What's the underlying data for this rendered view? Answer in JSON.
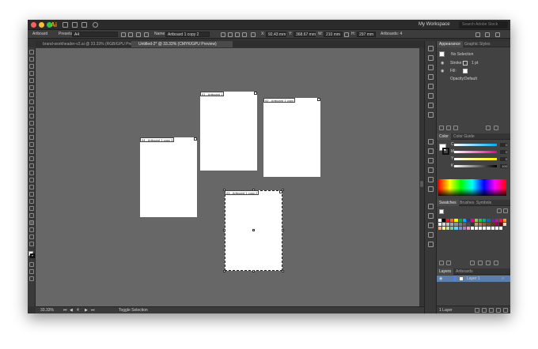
{
  "menubar": {
    "app_logo": "Ai",
    "workspace": "My Workspace",
    "search_placeholder": "Search Adobe Stock",
    "traffic_colors": [
      "#ff5f57",
      "#febc2e",
      "#28c840"
    ]
  },
  "control_bar": {
    "artboard_label": "Artboard",
    "presets_label": "Presets:",
    "preset_value": "A4",
    "name_label": "Name:",
    "name_value": "Artboard 1 copy 2",
    "x_label": "X:",
    "x_value": "92.43 mm",
    "y_label": "Y:",
    "y_value": "368.67 mm",
    "w_label": "W:",
    "w_value": "210 mm",
    "h_label": "H:",
    "h_value": "297 mm",
    "artboards_label": "Artboards: 4"
  },
  "tabs": [
    {
      "label": "brand-workheader-v2.ai @ 33.33% (RGB/GPU Preview)"
    },
    {
      "label": "Untitled-2* @ 33.33% (CMYK/GPU Preview)"
    }
  ],
  "artboards": [
    {
      "label": "01 - Artboard 1"
    },
    {
      "label": "02 - Artboard 1 copy"
    },
    {
      "label": "03 - Artboard 1 copy 2"
    },
    {
      "label": "04 - Artboard 1 copy 3"
    }
  ],
  "status": {
    "zoom": "33.33%",
    "page": "4",
    "mode": "Toggle Selection"
  },
  "appearance": {
    "tab_active": "Appearance",
    "tab_other": "Graphic Styles",
    "no_selection": "No Selection",
    "stroke_label": "Stroke:",
    "stroke_value": "1 pt",
    "fill_label": "Fill:",
    "opacity_label": "Opacity:",
    "opacity_value": "Default"
  },
  "color_panel": {
    "tab_active": "Color",
    "tab_other": "Color Guide",
    "channels": [
      {
        "name": "C",
        "value": "0"
      },
      {
        "name": "M",
        "value": "0"
      },
      {
        "name": "Y",
        "value": "0"
      },
      {
        "name": "K",
        "value": "100"
      }
    ]
  },
  "swatches_panel": {
    "tabs": [
      "Swatches",
      "Brushes",
      "Symbols"
    ]
  },
  "layers_panel": {
    "tab_active": "Layers",
    "tab_other": "Artboards",
    "layer_name": "Layer 1",
    "layer_color": "#4f7fff",
    "footer": "1 Layer"
  },
  "swatch_colors": [
    "#ffffff",
    "#000000",
    "#ee1c25",
    "#f26522",
    "#fff200",
    "#00a651",
    "#00aeef",
    "#2e3192",
    "#ec008c",
    "#8dc63f",
    "#39b54a",
    "#00a99d",
    "#0072bc",
    "#662d91",
    "#92278f",
    "#ed145b",
    "#f7941d",
    "#f0f0f0",
    "#d7d7d7",
    "#c0c0c0",
    "#a8a8a8",
    "#919191",
    "#7a7a7a",
    "#636363",
    "#4c4c4c",
    "#353535",
    "#c69c6d",
    "#a67c52",
    "#8c6239",
    "#754c24",
    "#603913",
    "#9e005d",
    "#790000",
    "#fbd5b5",
    "#f9ad81",
    "#fff799",
    "#c4df9b",
    "#82ca9c",
    "#6dcff6",
    "#8393ca",
    "#a186be",
    "#f49ac1",
    "#ffffff",
    "#ffffff",
    "#ffffff",
    "#ffffff",
    "#ffffff",
    "#ffffff",
    "#ffffff",
    "#ffffff"
  ]
}
